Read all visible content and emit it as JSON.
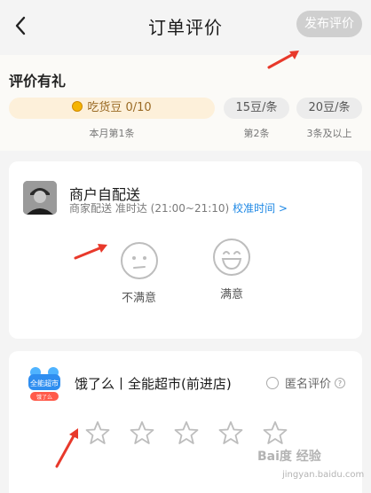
{
  "header": {
    "title": "订单评价",
    "publish_label": "发布评价"
  },
  "reward": {
    "title": "评价有礼",
    "tiers": [
      {
        "label": "吃货豆 0/10",
        "sub": "本月第1条"
      },
      {
        "label": "15豆/条",
        "sub": "第2条"
      },
      {
        "label": "20豆/条",
        "sub": "3条及以上"
      }
    ]
  },
  "delivery_card": {
    "name": "商户自配送",
    "delivery_type": "商家配送",
    "eta": "准时达 (21:00~21:10)",
    "calibrate_label": "校准时间 >",
    "options": [
      {
        "label": "不满意",
        "icon": "neutral-face-icon"
      },
      {
        "label": "满意",
        "icon": "happy-face-icon"
      }
    ]
  },
  "store_card": {
    "logo_text": "全能超市",
    "logo_sub": "饿了么",
    "name": "饿了么丨全能超市(前进店)",
    "anonymous_label": "匿名评价",
    "stars": 5
  },
  "watermark": {
    "main": "Bai度 经验",
    "sub": "jingyan.baidu.com"
  },
  "colors": {
    "accent": "#1e88e5",
    "arrow": "#e8392b",
    "publish_bg": "#cfcfcf",
    "coin": "#f5b400"
  }
}
